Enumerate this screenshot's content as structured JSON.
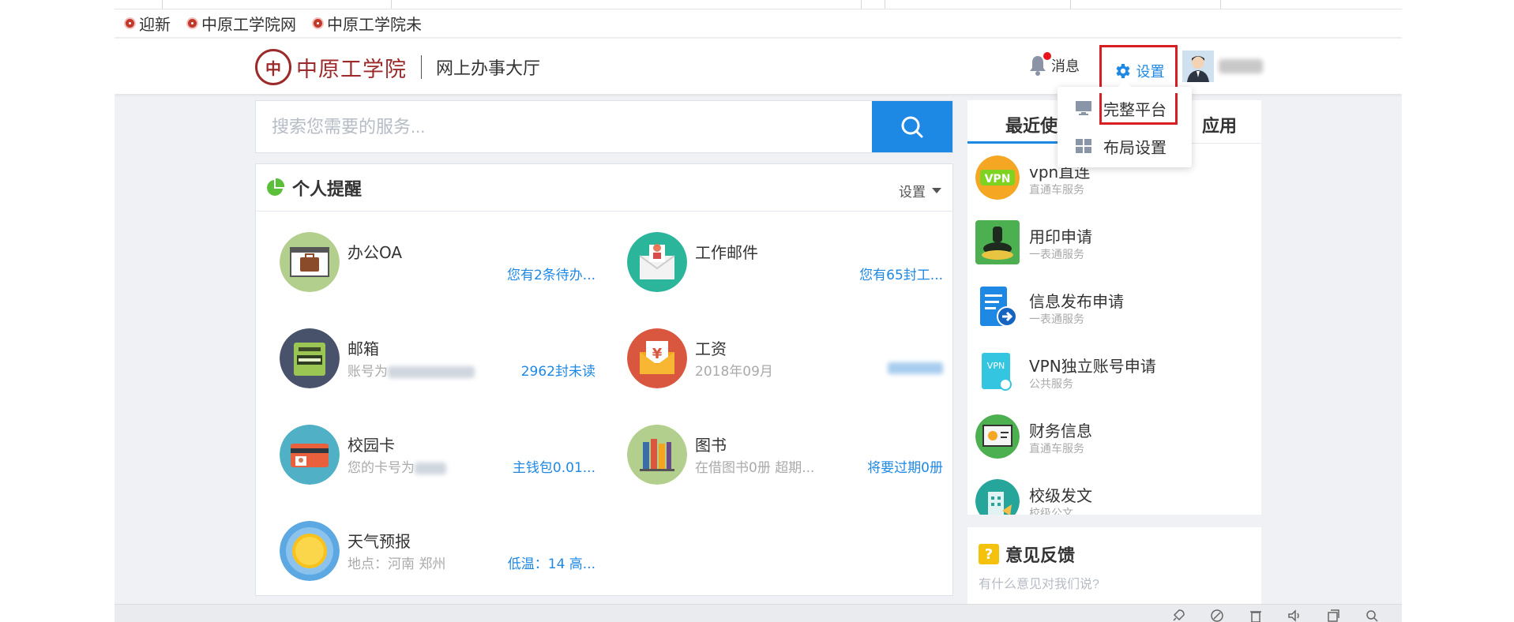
{
  "bookmarks": [
    {
      "label": "迎新"
    },
    {
      "label": "中原工学院网"
    },
    {
      "label": "中原工学院未"
    }
  ],
  "header": {
    "school_name": "中原工学院",
    "seal_char": "中",
    "portal_title": "网上办事大厅",
    "messages_label": "消息",
    "settings_label": "设置"
  },
  "dropdown": {
    "items": [
      {
        "label": "完整平台",
        "icon": "monitor-icon"
      },
      {
        "label": "布局设置",
        "icon": "layout-grid-icon"
      }
    ]
  },
  "search": {
    "placeholder": "搜索您需要的服务..."
  },
  "reminders": {
    "title": "个人提醒",
    "settings_label": "设置",
    "cards": [
      {
        "name": "办公OA",
        "sub": "",
        "right": "您有2条待办...",
        "icon": "briefcase-icon",
        "color": "#b3cf8e"
      },
      {
        "name": "工作邮件",
        "sub": "",
        "right": "您有65封工...",
        "icon": "envelope-icon",
        "color": "#2bb59a"
      },
      {
        "name": "邮箱",
        "sub": "账号为",
        "right": "2962封未读",
        "icon": "mailbox-icon",
        "color": "#48526b"
      },
      {
        "name": "工资",
        "sub": "2018年09月",
        "right": "",
        "icon": "salary-icon",
        "color": "#d9573f"
      },
      {
        "name": "校园卡",
        "sub": "您的卡号为",
        "right": "主钱包0.01...",
        "icon": "card-icon",
        "color": "#4fb0c6"
      },
      {
        "name": "图书",
        "sub": "在借图书0册 超期...",
        "right": "将要过期0册",
        "icon": "books-icon",
        "color": "#b3cf8e"
      },
      {
        "name": "天气预报",
        "sub": "地点：河南 郑州",
        "right": "低温：14 高...",
        "icon": "sun-icon",
        "color": "#5ba8e2"
      }
    ]
  },
  "recent": {
    "tab_left": "最近使",
    "tab_right": "应用",
    "apps": [
      {
        "name": "vpn直连",
        "sub": "直通车服务",
        "icon": "vpn-icon"
      },
      {
        "name": "用印申请",
        "sub": "一表通服务",
        "icon": "stamp-icon"
      },
      {
        "name": "信息发布申请",
        "sub": "一表通服务",
        "icon": "publish-icon"
      },
      {
        "name": "VPN独立账号申请",
        "sub": "公共服务",
        "icon": "vpn-account-icon"
      },
      {
        "name": "财务信息",
        "sub": "直通车服务",
        "icon": "finance-icon"
      },
      {
        "name": "校级发文",
        "sub": "校级公文",
        "icon": "document-icon"
      }
    ]
  },
  "feedback": {
    "title": "意见反馈",
    "placeholder": "有什么意见对我们说?"
  },
  "bottom_icons": [
    "rocket-icon",
    "leaf-icon",
    "trash-icon",
    "speaker-icon",
    "window-icon",
    "search-icon"
  ]
}
